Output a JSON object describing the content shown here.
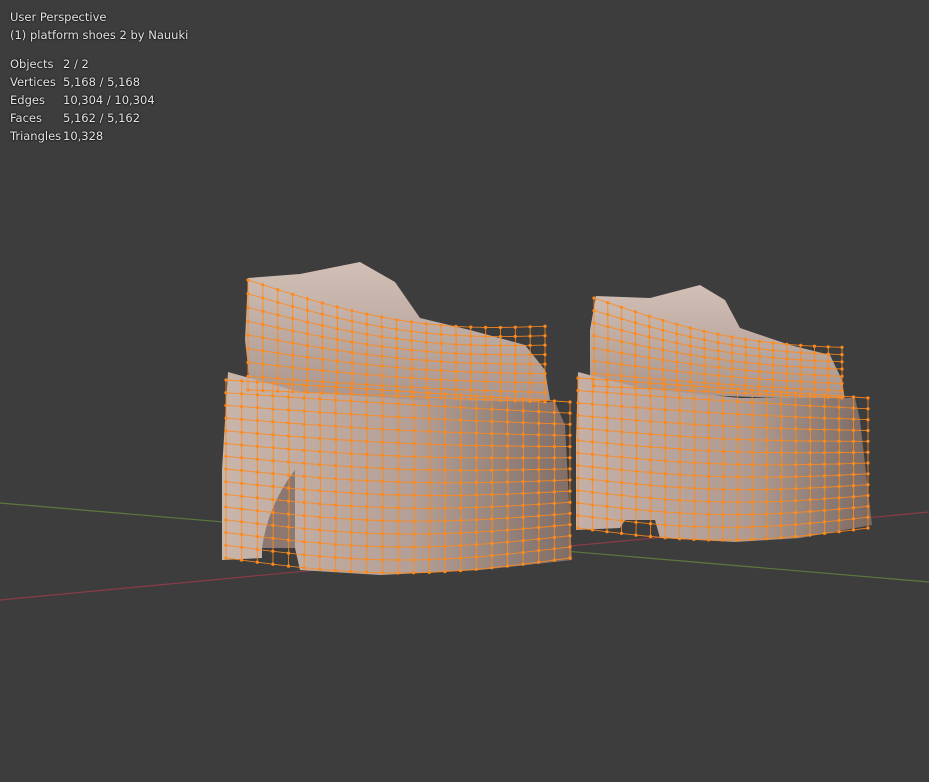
{
  "viewport": {
    "view_name": "User Perspective",
    "object_name": "(1) platform shoes 2 by Nauuki"
  },
  "stats": [
    {
      "label": "Objects",
      "value": "2 / 2"
    },
    {
      "label": "Vertices",
      "value": "5,168 / 5,168"
    },
    {
      "label": "Edges",
      "value": "10,304 / 10,304"
    },
    {
      "label": "Faces",
      "value": "5,162 / 5,162"
    },
    {
      "label": "Triangles",
      "value": "10,328"
    }
  ],
  "colors": {
    "background": "#3d3d3d",
    "mesh_fill": "#b09a90",
    "wire_selected": "#ff8a1c",
    "axis_x": "#8a3b48",
    "axis_y": "#5d7a3e"
  }
}
